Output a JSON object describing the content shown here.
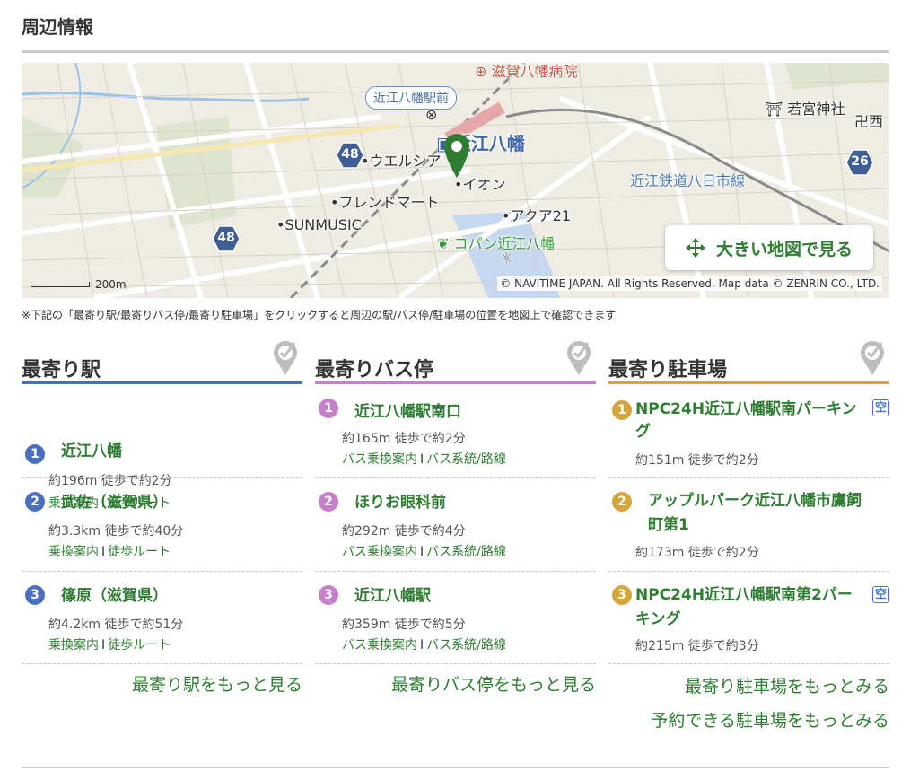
{
  "section_title": "周辺情報",
  "map": {
    "labels": {
      "hospital": "滋賀八幡病院",
      "bus_stop_box": "近江八幡駅前",
      "station": "近江八幡",
      "shrine": "若宮神社",
      "temple": "西",
      "welcia": "ウエルシア",
      "aeon": "イオン",
      "friendmart": "フレンドマート",
      "sunmusic": "SUNMUSIC",
      "akua": "アクア21",
      "copan": "コパン近江八幡",
      "railway": "近江鉄道八日市線"
    },
    "route_badges": [
      "48",
      "48",
      "26"
    ],
    "big_map_button": "大きい地図で見る",
    "scale": "200m",
    "copyright": "© NAVITIME JAPAN. All Rights Reserved. Map data © ZENRIN CO., LTD."
  },
  "note": "※下記の「最寄り駅/最寄りバス停/最寄り駐車場」をクリックすると周辺の駅/バス停/駐車場の位置を地図上で確認できます",
  "columns": {
    "station": {
      "title": "最寄り駅",
      "accent": "#4a6fc0",
      "items": [
        {
          "num": "1",
          "name": "近江八幡",
          "dist": "約196m 徒歩で約2分",
          "link1": "乗換案内",
          "link2": "徒歩ルート"
        },
        {
          "num": "2",
          "name": "武佐（滋賀県）",
          "dist": "約3.3km 徒歩で約40分",
          "link1": "乗換案内",
          "link2": "徒歩ルート"
        },
        {
          "num": "3",
          "name": "篠原（滋賀県）",
          "dist": "約4.2km 徒歩で約51分",
          "link1": "乗換案内",
          "link2": "徒歩ルート"
        }
      ],
      "more": "最寄り駅をもっと見る"
    },
    "bus": {
      "title": "最寄りバス停",
      "accent": "#c67fcb",
      "items": [
        {
          "num": "1",
          "name": "近江八幡駅南口",
          "dist": "約165m 徒歩で約2分",
          "link1": "バス乗換案内",
          "link2": "バス系統/路線"
        },
        {
          "num": "2",
          "name": "ほりお眼科前",
          "dist": "約292m 徒歩で約4分",
          "link1": "バス乗換案内",
          "link2": "バス系統/路線"
        },
        {
          "num": "3",
          "name": "近江八幡駅",
          "dist": "約359m 徒歩で約5分",
          "link1": "バス乗換案内",
          "link2": "バス系統/路線"
        }
      ],
      "more": "最寄りバス停をもっと見る"
    },
    "parking": {
      "title": "最寄り駐車場",
      "accent": "#d4a53a",
      "items": [
        {
          "num": "1",
          "name_l1": "NPC24H近江八幡駅南パーキン",
          "name_l2": "グ",
          "badge": "空",
          "dist": "約151m 徒歩で約2分"
        },
        {
          "num": "2",
          "name_l1": "アップルパーク近江八幡市鷹飼",
          "name_l2": "町第1",
          "dist": "約173m 徒歩で約2分"
        },
        {
          "num": "3",
          "name_l1": "NPC24H近江八幡駅南第2パー",
          "name_l2": "キング",
          "badge": "空",
          "dist": "約215m 徒歩で約3分"
        }
      ],
      "more": "最寄り駐車場をもっとみる",
      "more2": "予約できる駐車場をもっとみる"
    }
  }
}
